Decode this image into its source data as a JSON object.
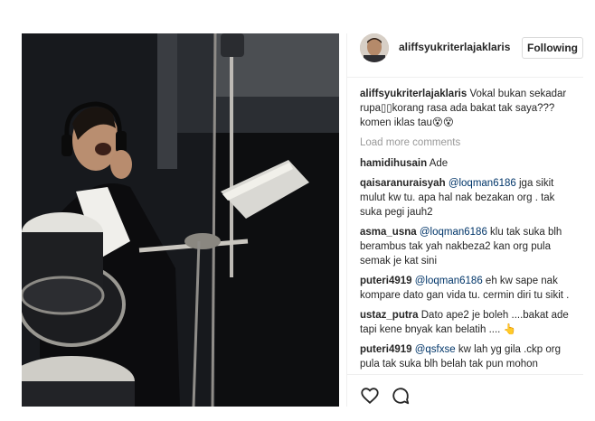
{
  "header": {
    "username": "aliffsyukriterlajaklaris",
    "follow_label": "Following"
  },
  "caption": {
    "user": "aliffsyukriterlajaklaris",
    "text": "Vokal bukan sekadar rupa▯▯korang rasa ada bakat tak saya??? komen iklas tau😵😵"
  },
  "load_more": "Load more comments",
  "comments": [
    {
      "user": "hamidihusain",
      "mention": "",
      "text": "Ade"
    },
    {
      "user": "qaisaranuraisyah",
      "mention": "@loqman6186",
      "text": "jga sikit mulut kw tu. apa hal nak bezakan org . tak suka pegi jauh2"
    },
    {
      "user": "asma_usna",
      "mention": "@loqman6186",
      "text": "klu tak suka blh berambus tak yah nakbeza2 kan org pula semak je kat sini"
    },
    {
      "user": "puteri4919",
      "mention": "@loqman6186",
      "text": "eh kw sape nak kompare dato gan vida tu. cermin diri tu sikit ."
    },
    {
      "user": "ustaz_putra",
      "mention": "",
      "text": "Dato ape2 je boleh ....bakat ade tapi kene bnyak kan belatih .... 👆"
    },
    {
      "user": "puteri4919",
      "mention": "@qsfxse",
      "text": "kw lah yg gila .ckp org pula tak suka blh belah tak pun mohon"
    }
  ],
  "actions": {
    "like_icon": "heart-icon",
    "comment_icon": "comment-icon"
  }
}
